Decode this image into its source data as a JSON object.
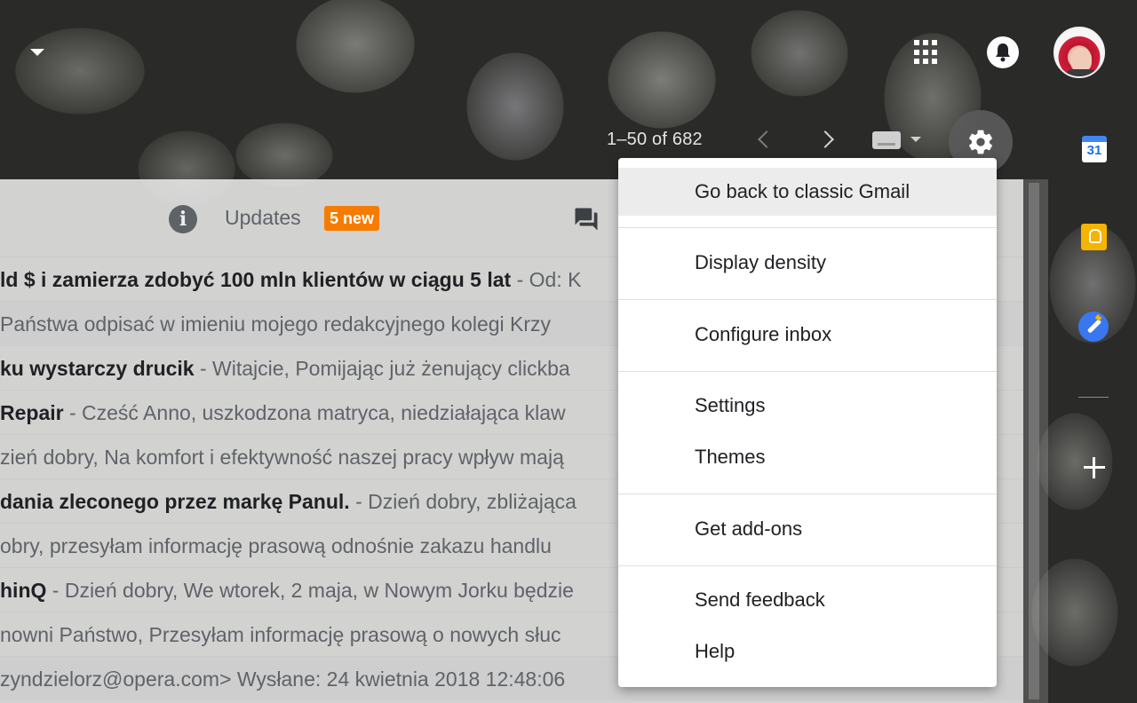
{
  "pager": {
    "text": "1–50 of 682"
  },
  "tabs": {
    "updates_label": "Updates",
    "updates_badge": "5 new"
  },
  "emails": [
    {
      "subject": "ld $ i zamierza zdobyć 100 mln klientów w ciągu 5 lat",
      "snippet": " - Od: K",
      "highlight": false
    },
    {
      "subject": "",
      "snippet": " Państwa odpisać w imieniu mojego redakcyjnego kolegi Krzy",
      "highlight": true
    },
    {
      "subject": "ku wystarczy drucik",
      "snippet": " - Witajcie, Pomijając już żenujący clickba",
      "highlight": false
    },
    {
      "subject": "Repair",
      "snippet": " - Cześć Anno, uszkodzona matryca, niedziałająca klaw",
      "highlight": false
    },
    {
      "subject": "",
      "snippet": "zień dobry, Na komfort i efektywność naszej pracy wpływ mają",
      "highlight": false
    },
    {
      "subject": "dania zleconego przez markę Panul.",
      "snippet": " - Dzień dobry, zbliżająca",
      "highlight": false
    },
    {
      "subject": "",
      "snippet": "obry, przesyłam informację prasową odnośnie zakazu handlu",
      "highlight": false
    },
    {
      "subject": "hinQ",
      "snippet": " - Dzień dobry, We wtorek, 2 maja, w Nowym Jorku będzie",
      "highlight": false
    },
    {
      "subject": "",
      "snippet": "nowni Państwo, Przesyłam informację prasową o nowych słuc",
      "highlight": false
    },
    {
      "subject": "",
      "snippet": "zyndzielorz@opera.com> Wysłane: 24 kwietnia 2018 12:48:06",
      "highlight": true
    }
  ],
  "menu": {
    "classic": "Go back to classic Gmail",
    "density": "Display density",
    "configure": "Configure inbox",
    "settings": "Settings",
    "themes": "Themes",
    "addons": "Get add-ons",
    "feedback": "Send feedback",
    "help": "Help"
  },
  "side_panel": {
    "calendar_day": "31"
  },
  "colors": {
    "badge": "#f57c00",
    "calendar": "#4285f4",
    "keep": "#f4b400",
    "tasks": "#3a76f0"
  },
  "icons": [
    "apps-icon",
    "bell-icon",
    "avatar",
    "chevron-left-icon",
    "chevron-right-icon",
    "keyboard-icon",
    "gear-icon",
    "info-icon",
    "forums-icon",
    "calendar-icon",
    "keep-icon",
    "tasks-icon",
    "plus-icon"
  ]
}
